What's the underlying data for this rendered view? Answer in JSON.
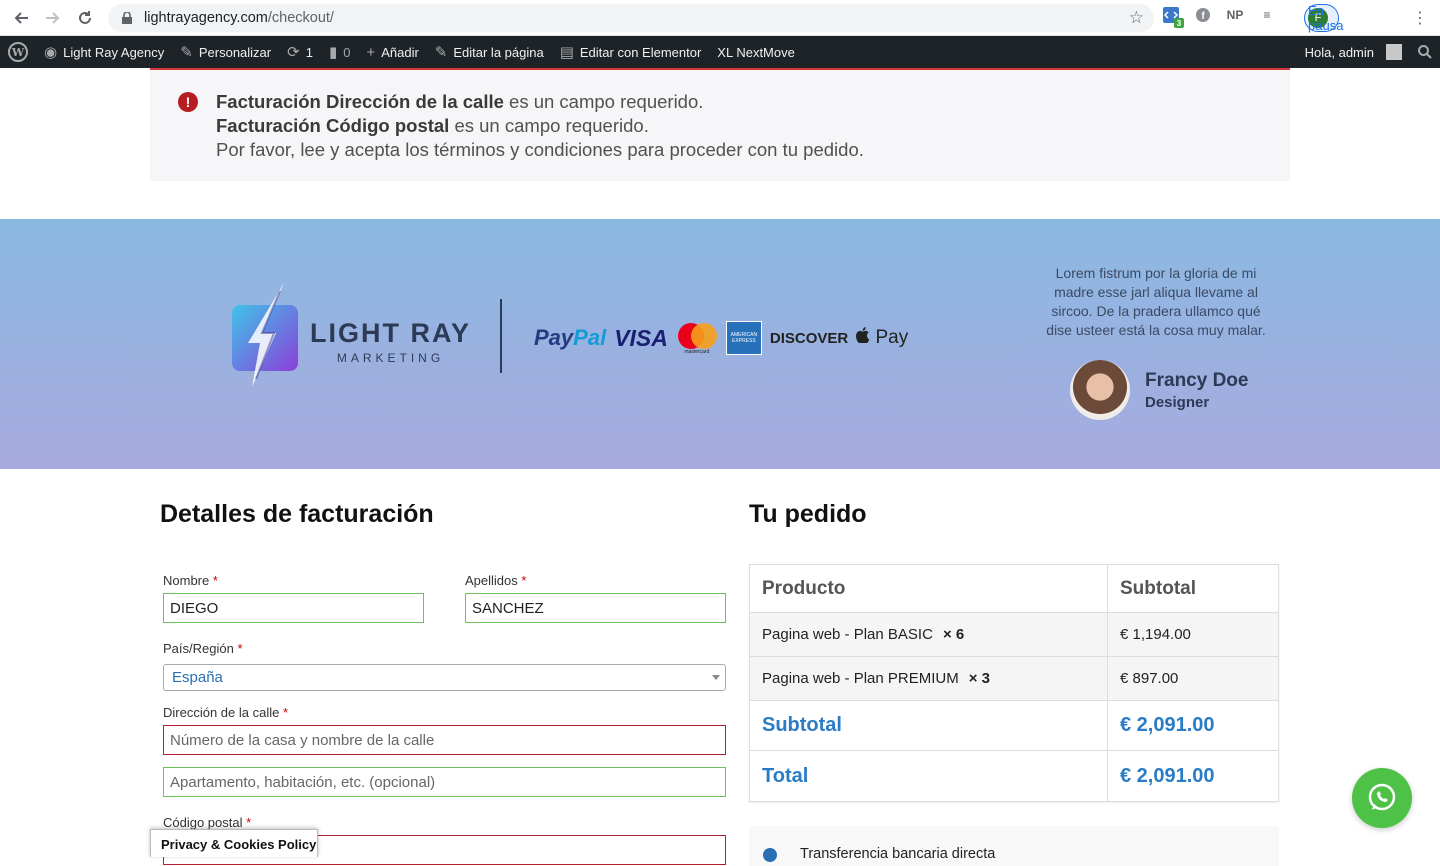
{
  "browser": {
    "url_host": "lightrayagency.com",
    "url_path": "/checkout/",
    "ext_badge": "3",
    "ext_np": "NP",
    "profile_initial": "F",
    "profile_label": "En pausa"
  },
  "adminbar": {
    "site": "Light Ray Agency",
    "customize": "Personalizar",
    "updates_count": "1",
    "comments_count": "0",
    "new": "Añadir",
    "edit_page": "Editar la página",
    "elementor": "Editar con Elementor",
    "nextmove": "XL NextMove",
    "greeting": "Hola, admin"
  },
  "notice": {
    "line1_bold": "Facturación Dirección de la calle",
    "line1_rest": " es un campo requerido.",
    "line2_bold": "Facturación Código postal",
    "line2_rest": " es un campo requerido.",
    "line3": "Por favor, lee y acepta los términos y condiciones para proceder con tu pedido."
  },
  "hero": {
    "brand_main": "LIGHT RAY",
    "brand_sub": "MARKETING",
    "pay_paypal_a": "Pay",
    "pay_paypal_b": "Pal",
    "pay_visa": "VISA",
    "pay_mc": "mastercard",
    "pay_amex": "AMERICAN EXPRESS",
    "pay_discover": "DISCOVER",
    "pay_apple": " Pay",
    "testimonial": "Lorem fistrum por la gloria de mi madre esse jarl aliqua llevame al sircoo. De la pradera ullamco qué dise usteer está la cosa muy malar.",
    "person_name": "Francy Doe",
    "person_role": "Designer"
  },
  "billing": {
    "title": "Detalles de facturación",
    "first_name_label": "Nombre",
    "first_name_value": "DIEGO",
    "last_name_label": "Apellidos",
    "last_name_value": "SANCHEZ",
    "country_label": "País/Región",
    "country_value": "España",
    "street_label": "Dirección de la calle",
    "street_placeholder": "Número de la casa y nombre de la calle",
    "apt_placeholder": "Apartamento, habitación, etc. (opcional)",
    "postcode_label": "Código postal",
    "required_mark": "*"
  },
  "order": {
    "title": "Tu pedido",
    "col_product": "Producto",
    "col_subtotal": "Subtotal",
    "items": [
      {
        "name": "Pagina web - Plan BASIC",
        "qty": "× 6",
        "total": "€ 1,194.00"
      },
      {
        "name": "Pagina web - Plan PREMIUM",
        "qty": "× 3",
        "total": "€ 897.00"
      }
    ],
    "subtotal_label": "Subtotal",
    "subtotal_value": "€ 2,091.00",
    "total_label": "Total",
    "total_value": "€ 2,091.00",
    "payment_method": "Transferencia bancaria directa"
  },
  "cookie_label": "Privacy & Cookies Policy",
  "colors": {
    "accent": "#2a7cc7",
    "error": "#b0212b",
    "valid": "#6dc35b",
    "adminbar": "#1d2327"
  }
}
